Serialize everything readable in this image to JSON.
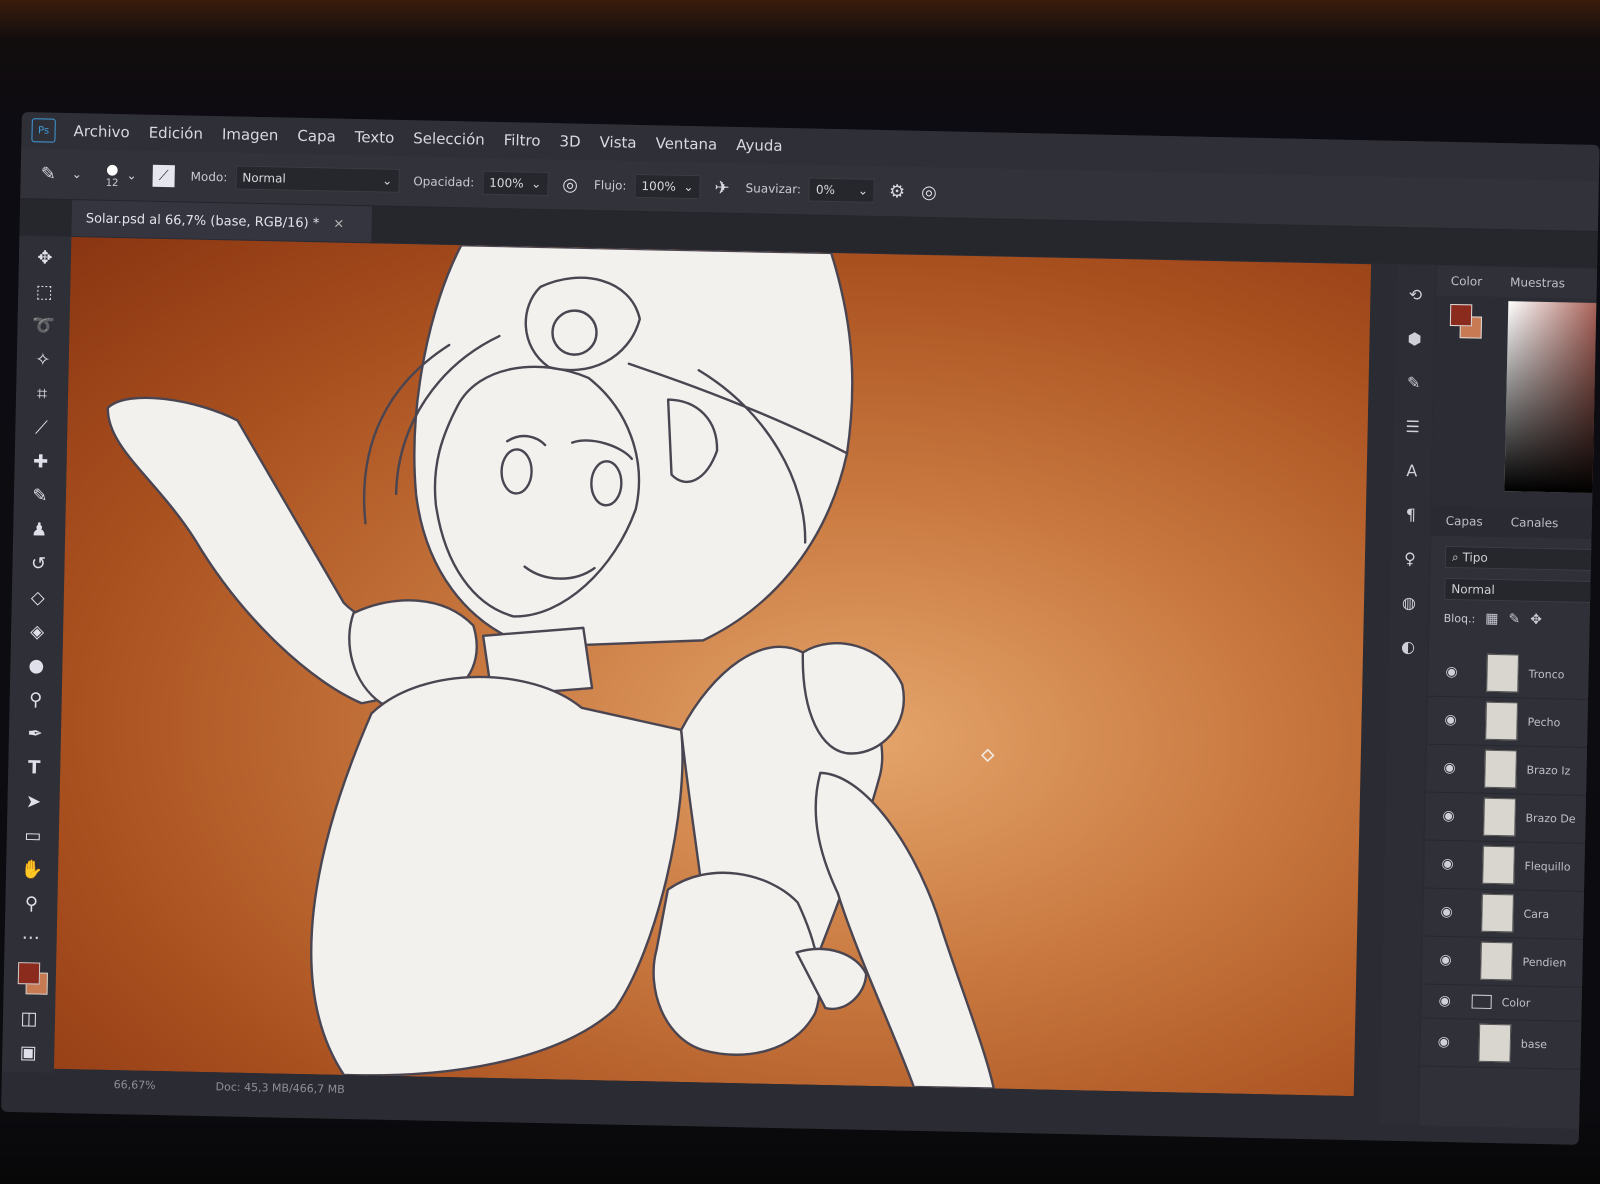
{
  "app": {
    "logo": "Ps"
  },
  "menu": [
    "Archivo",
    "Edición",
    "Imagen",
    "Capa",
    "Texto",
    "Selección",
    "Filtro",
    "3D",
    "Vista",
    "Ventana",
    "Ayuda"
  ],
  "options": {
    "brush_size": "12",
    "mode_label": "Modo:",
    "mode_value": "Normal",
    "opacity_label": "Opacidad:",
    "opacity_value": "100%",
    "flow_label": "Flujo:",
    "flow_value": "100%",
    "smoothing_label": "Suavizar:",
    "smoothing_value": "0%"
  },
  "document": {
    "tab_title": "Solar.psd al 66,7% (base, RGB/16) *",
    "close": "×",
    "zoom": "66,67%",
    "doc_size": "Doc: 45,3 MB/466,7 MB"
  },
  "panel": {
    "tabs": [
      "Color",
      "Muestras"
    ],
    "fg_color": "#8b2b1e",
    "bg_color": "#c87b52",
    "layer_tabs": [
      "Capas",
      "Canales"
    ],
    "filter": "⌕ Tipo",
    "blend": "Normal",
    "lock_label": "Bloq.:"
  },
  "layers": [
    {
      "name": "Tronco"
    },
    {
      "name": "Pecho"
    },
    {
      "name": "Brazo Iz"
    },
    {
      "name": "Brazo De"
    },
    {
      "name": "Flequillo"
    },
    {
      "name": "Cara"
    },
    {
      "name": "Pendien"
    },
    {
      "name": "Color",
      "type": "folder"
    },
    {
      "name": "base"
    }
  ]
}
